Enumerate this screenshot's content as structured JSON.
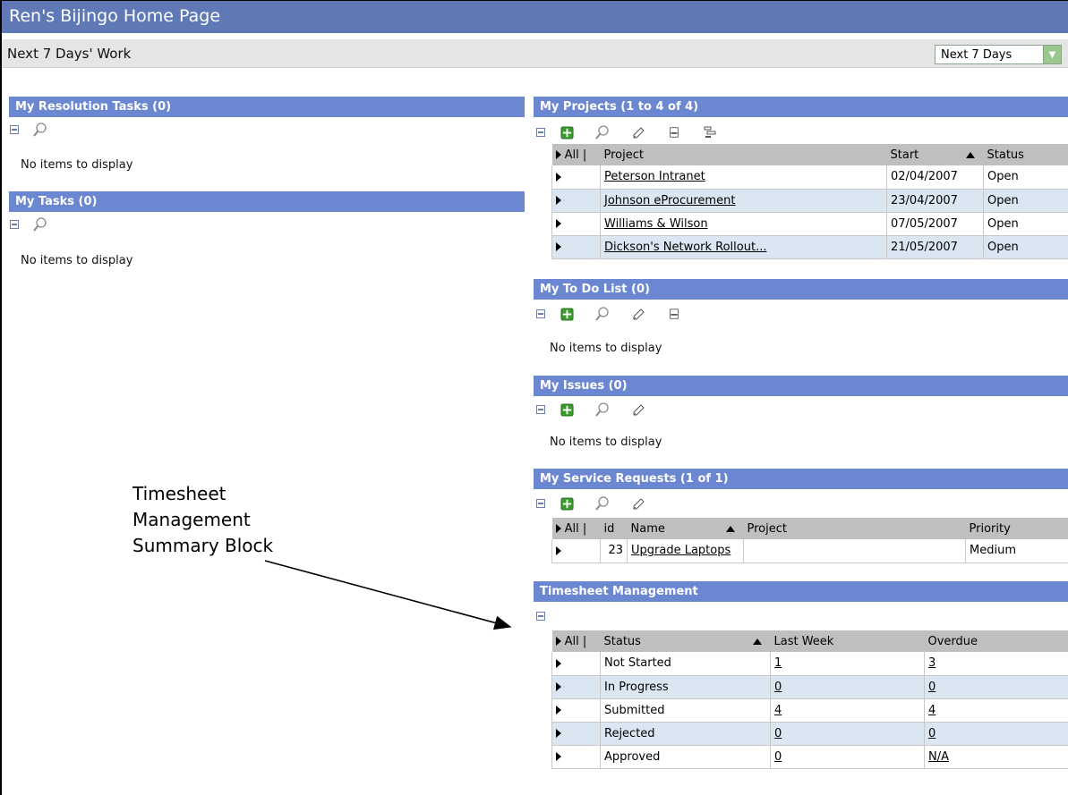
{
  "window": {
    "title": "Ren's Bijingo Home Page"
  },
  "subheader": {
    "title": "Next 7 Days' Work",
    "period_select": "Next 7 Days"
  },
  "resolution_tasks": {
    "title": "My Resolution Tasks (0)",
    "empty": "No items to display"
  },
  "my_tasks": {
    "title": "My Tasks (0)",
    "empty": "No items to display"
  },
  "projects": {
    "title": "My Projects (1 to 4 of 4)",
    "columns": {
      "all": "All |",
      "project": "Project",
      "start": "Start",
      "status": "Status"
    },
    "rows": [
      {
        "project": "Peterson Intranet",
        "start": "02/04/2007",
        "status": "Open"
      },
      {
        "project": "Johnson eProcurement",
        "start": "23/04/2007",
        "status": "Open"
      },
      {
        "project": "Williams & Wilson",
        "start": "07/05/2007",
        "status": "Open"
      },
      {
        "project": "Dickson's Network Rollout...",
        "start": "21/05/2007",
        "status": "Open"
      }
    ]
  },
  "todo": {
    "title": "My To Do List (0)",
    "empty": "No items to display"
  },
  "issues": {
    "title": "My Issues (0)",
    "empty": "No items to display"
  },
  "service_requests": {
    "title": "My Service Requests (1 of 1)",
    "columns": {
      "all": "All |",
      "id": "id",
      "name": "Name",
      "project": "Project",
      "priority": "Priority"
    },
    "rows": [
      {
        "id": "23",
        "name": "Upgrade Laptops",
        "project": "",
        "priority": "Medium"
      }
    ]
  },
  "timesheet": {
    "title": "Timesheet Management",
    "columns": {
      "all": "All |",
      "status": "Status",
      "last_week": "Last Week",
      "overdue": "Overdue"
    },
    "rows": [
      {
        "status": "Not Started",
        "last_week": "1",
        "overdue": "3"
      },
      {
        "status": "In Progress",
        "last_week": "0",
        "overdue": "0"
      },
      {
        "status": "Submitted",
        "last_week": "4",
        "overdue": "4"
      },
      {
        "status": "Rejected",
        "last_week": "0",
        "overdue": "0"
      },
      {
        "status": "Approved",
        "last_week": "0",
        "overdue": "N/A"
      }
    ]
  },
  "annotation": {
    "line1": "Timesheet",
    "line2": "Management",
    "line3": "Summary Block"
  },
  "colors": {
    "title_bar": "#5f78b6",
    "section_header": "#6b87d1",
    "alt_row": "#dbe6f3",
    "column_header": "#bfbfbf"
  }
}
